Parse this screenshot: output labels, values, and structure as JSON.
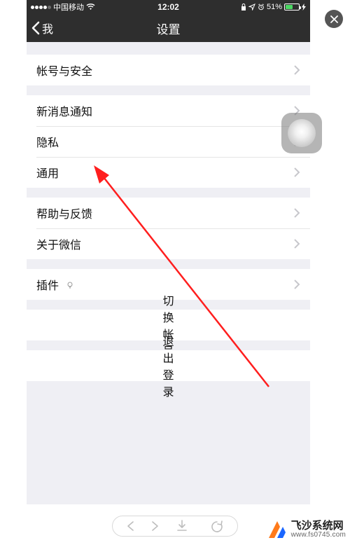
{
  "status_bar": {
    "carrier": "中国移动",
    "time": "12:02",
    "battery_pct": "51%"
  },
  "nav": {
    "back_label": "我",
    "title": "设置"
  },
  "groups": [
    {
      "items": [
        {
          "key": "account",
          "label": "帐号与安全"
        }
      ]
    },
    {
      "items": [
        {
          "key": "notifications",
          "label": "新消息通知"
        },
        {
          "key": "privacy",
          "label": "隐私"
        },
        {
          "key": "general",
          "label": "通用"
        }
      ]
    },
    {
      "items": [
        {
          "key": "help",
          "label": "帮助与反馈"
        },
        {
          "key": "about",
          "label": "关于微信"
        }
      ]
    },
    {
      "items": [
        {
          "key": "plugins",
          "label": "插件",
          "has_bulb": true
        }
      ]
    },
    {
      "items": [
        {
          "key": "switch",
          "label": "切换帐号",
          "center": true
        }
      ]
    },
    {
      "items": [
        {
          "key": "logout",
          "label": "退出登录",
          "center": true
        }
      ]
    }
  ],
  "watermark": {
    "title": "飞沙系统网",
    "sub": "www.fs0745.com"
  },
  "colors": {
    "arrow": "#ff1e1e",
    "bg_header": "#2e2e2e",
    "bg_content": "#efeff4"
  }
}
